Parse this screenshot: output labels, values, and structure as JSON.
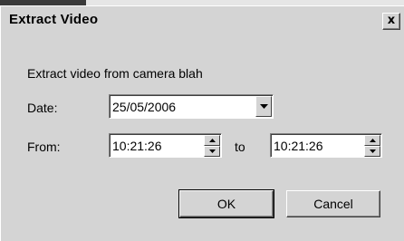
{
  "window": {
    "title": "Extract Video",
    "close_label": "x"
  },
  "description": "Extract video from camera blah",
  "date": {
    "label": "Date:",
    "value": "25/05/2006"
  },
  "time": {
    "from_label": "From:",
    "from_value": "10:21:26",
    "to_label": "to",
    "to_value": "10:21:26"
  },
  "buttons": {
    "ok": "OK",
    "cancel": "Cancel"
  },
  "icons": {
    "dropdown": "chevron-down-icon",
    "spin_up": "arrow-up-icon",
    "spin_down": "arrow-down-icon",
    "close": "close-icon"
  }
}
